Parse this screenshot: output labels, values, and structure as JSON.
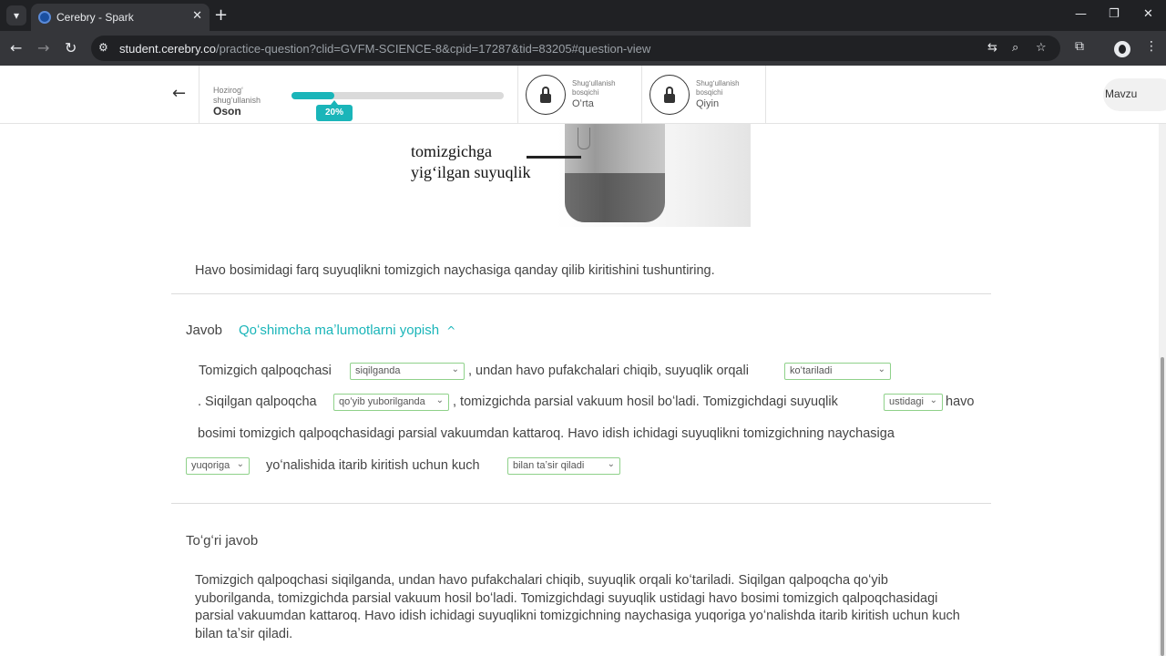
{
  "browser": {
    "tab_title": "Cerebry - Spark",
    "url_domain": "student.cerebry.co",
    "url_rest": "/practice-question?clid=GVFM-SCIENCE-8&cpid=17287&tid=83205#question-view"
  },
  "header": {
    "current_label": "Hozirogʻ shugʻullanish",
    "current_value": "Oson",
    "progress_percent": 20,
    "progress_label": "20%",
    "levels": [
      {
        "label": "Shugʻullanish bosqichi",
        "value": "Oʻrta",
        "locked": true
      },
      {
        "label": "Shugʻullanish bosqichi",
        "value": "Qiyin",
        "locked": true
      }
    ],
    "mavzu_label": "Mavzu"
  },
  "figure": {
    "label_line1": "tomizgichga",
    "label_line2": "yigʻilgan suyuqlik"
  },
  "question": "Havo bosimidagi farq suyuqlikni tomizgich naychasiga qanday qilib kiritishini tushuntiring.",
  "answer": {
    "javob_label": "Javob",
    "toggle_label": "Qoʻshimcha maʼlumotlarni yopish",
    "t1": "Tomizgich qalpoqchasi",
    "d1": "siqilganda",
    "t2": ", undan havo pufakchalari chiqib, suyuqlik orqali",
    "d2": "koʻtariladi",
    "t3": ". Siqilgan qalpoqcha",
    "d3": "qoʻyib yuborilganda",
    "t4": ", tomizgichda parsial vakuum hosil boʻladi. Tomizgichdagi suyuqlik",
    "d4": "ustidagi",
    "t5": "havo",
    "t6": "bosimi tomizgich qalpoqchasidagi parsial vakuumdan kattaroq. Havo idish ichidagi suyuqlikni tomizgichning naychasiga",
    "d5": "yuqoriga",
    "t7": "yoʻnalishida itarib kiritish uchun kuch",
    "d6": "bilan taʼsir qiladi"
  },
  "correct": {
    "title": "Toʻgʻri javob",
    "text": "Tomizgich qalpoqchasi siqilganda, undan havo pufakchalari chiqib, suyuqlik orqali koʻtariladi. Siqilgan qalpoqcha qoʻyib yuborilganda, tomizgichda parsial vakuum hosil boʻladi. Tomizgichdagi suyuqlik ustidagi havo bosimi tomizgich qalpoqchasidagi parsial vakuumdan kattaroq. Havo idish ichidagi suyuqlikni tomizgichning naychasiga yuqoriga yoʻnalishda itarib kiritish uchun kuch bilan taʼsir qiladi."
  },
  "colors": {
    "accent": "#1ab5b9",
    "dropdown_border": "#8fd18a"
  },
  "icons": [
    "tab-list-icon",
    "close-icon",
    "plus-icon",
    "minimize-icon",
    "maximize-icon",
    "back-icon",
    "forward-icon",
    "reload-icon",
    "site-info-icon",
    "translate-icon",
    "zoom-icon",
    "star-icon",
    "extensions-icon",
    "menu-icon",
    "lock-icon",
    "chevron-down-icon",
    "chevron-up-icon"
  ]
}
